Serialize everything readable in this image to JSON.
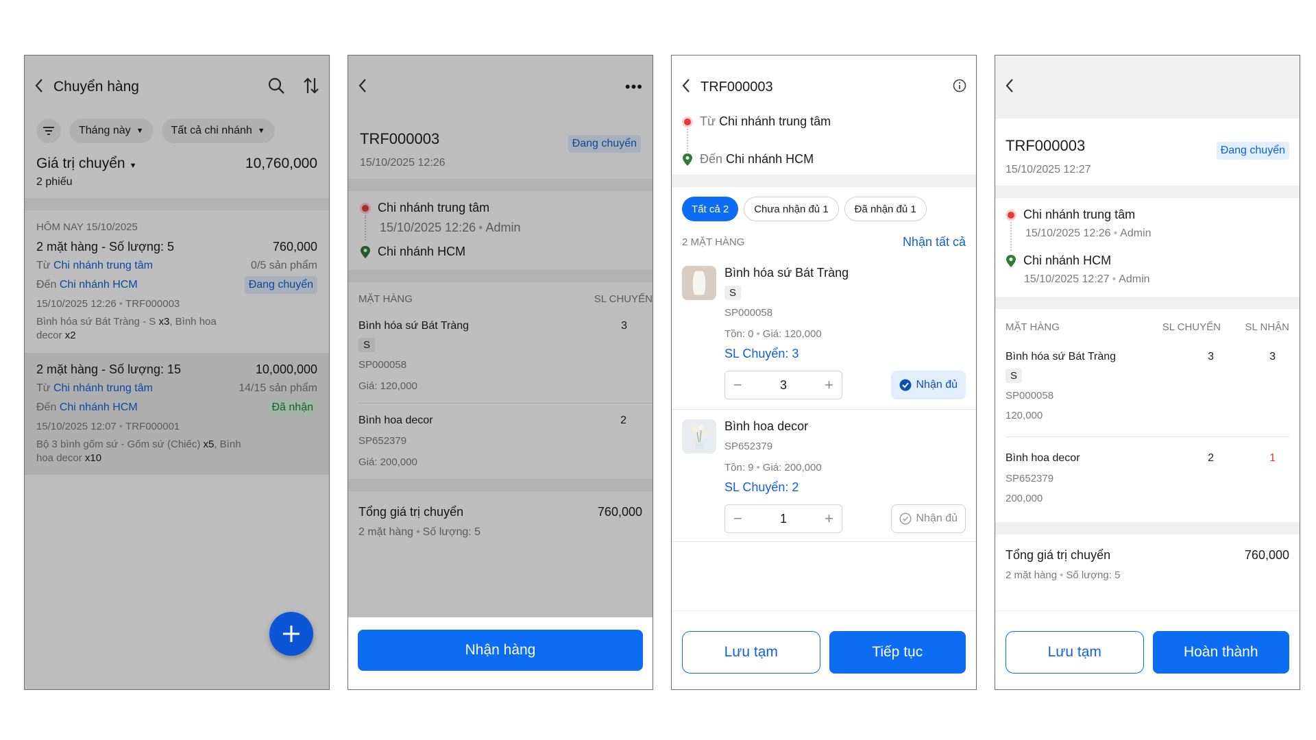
{
  "screen1": {
    "title": "Chuyển hàng",
    "filters": [
      "Tháng này",
      "Tất cả chi nhánh"
    ],
    "summary": {
      "label": "Giá trị chuyển",
      "value": "10,760,000",
      "count": "2 phiếu"
    },
    "date_header": "HÔM NAY 15/10/2025",
    "transfers": [
      {
        "title": "2 mặt hàng - Số lượng: 5",
        "amount": "760,000",
        "from_prefix": "Từ",
        "from": "Chi nhánh trung tâm",
        "progress": "0/5 sản phẩm",
        "to_prefix": "Đến",
        "to": "Chi nhánh HCM",
        "status": "Đang chuyển",
        "datetime": "15/10/2025 12:26",
        "code": "TRF000003",
        "items_text": "Bình hóa sứ Bát Tràng - S ",
        "items_qty1": "x3",
        "items_text2": ", Bình hoa decor ",
        "items_qty2": "x2"
      },
      {
        "title": "2 mặt hàng - Số lượng: 15",
        "amount": "10,000,000",
        "from_prefix": "Từ",
        "from": "Chi nhánh trung tâm",
        "progress": "14/15 sản phẩm",
        "to_prefix": "Đến",
        "to": "Chi nhánh HCM",
        "status": "Đã nhận",
        "datetime": "15/10/2025 12:07",
        "code": "TRF000001",
        "items_text": "Bộ 3 bình gốm sứ - Gốm sứ (Chiếc) ",
        "items_qty1": "x5",
        "items_text2": ", Bình hoa decor ",
        "items_qty2": "x10"
      }
    ]
  },
  "screen2": {
    "code": "TRF000003",
    "datetime": "15/10/2025 12:26",
    "status": "Đang chuyển",
    "from": "Chi nhánh trung tâm",
    "from_meta_time": "15/10/2025 12:26",
    "from_meta_user": "Admin",
    "to": "Chi nhánh HCM",
    "col_item": "MẶT HÀNG",
    "col_qty": "SL CHUYỂN",
    "items": [
      {
        "name": "Bình hóa sứ Bát Tràng",
        "size": "S",
        "sku": "SP000058",
        "price": "Giá: 120,000",
        "qty": "3"
      },
      {
        "name": "Bình hoa decor",
        "sku": "SP652379",
        "price": "Giá: 200,000",
        "qty": "2"
      }
    ],
    "total_label": "Tổng giá trị chuyển",
    "total_value": "760,000",
    "total_meta1": "2 mặt hàng",
    "total_meta2": "Số lượng: 5",
    "action": "Nhận hàng"
  },
  "screen3": {
    "code": "TRF000003",
    "from_prefix": "Từ",
    "from": "Chi nhánh trung tâm",
    "to_prefix": "Đến",
    "to": "Chi nhánh HCM",
    "tabs": [
      "Tất cả 2",
      "Chưa nhận đủ 1",
      "Đã nhận đủ 1"
    ],
    "count_label": "2 MẶT HÀNG",
    "receive_all": "Nhận tất cả",
    "items": [
      {
        "name": "Bình hóa sứ Bát Tràng",
        "size": "S",
        "sku": "SP000058",
        "stock": "Tồn: 0",
        "price": "Giá: 120,000",
        "transfer": "SL Chuyển: 3",
        "qty": "3",
        "receive": "Nhận đủ"
      },
      {
        "name": "Bình hoa decor",
        "sku": "SP652379",
        "stock": "Tồn: 9",
        "price": "Giá: 200,000",
        "transfer": "SL Chuyển: 2",
        "qty": "1",
        "receive": "Nhận đủ"
      }
    ],
    "save_draft": "Lưu tạm",
    "continue": "Tiếp tục"
  },
  "screen4": {
    "code": "TRF000003",
    "datetime": "15/10/2025 12:27",
    "status": "Đang chuyển",
    "from": "Chi nhánh trung tâm",
    "from_time": "15/10/2025 12:26",
    "from_user": "Admin",
    "to": "Chi nhánh HCM",
    "to_time": "15/10/2025 12:27",
    "to_user": "Admin",
    "col_item": "MẶT HÀNG",
    "col_transfer": "SL CHUYỂN",
    "col_received": "SL NHẬN",
    "items": [
      {
        "name": "Bình hóa sứ Bát Tràng",
        "size": "S",
        "sku": "SP000058",
        "price": "120,000",
        "transfer": "3",
        "received": "3"
      },
      {
        "name": "Bình hoa decor",
        "sku": "SP652379",
        "price": "200,000",
        "transfer": "2",
        "received": "1"
      }
    ],
    "total_label": "Tổng giá trị chuyển",
    "total_value": "760,000",
    "total_meta1": "2 mặt hàng",
    "total_meta2": "Số lượng: 5",
    "save_draft": "Lưu tạm",
    "complete": "Hoàn thành"
  },
  "colors": {
    "primary": "#0c6cf2",
    "link": "#0c62d6",
    "origin": "#e53935",
    "destination": "#2e7d32",
    "shortfall": "#e53935"
  }
}
